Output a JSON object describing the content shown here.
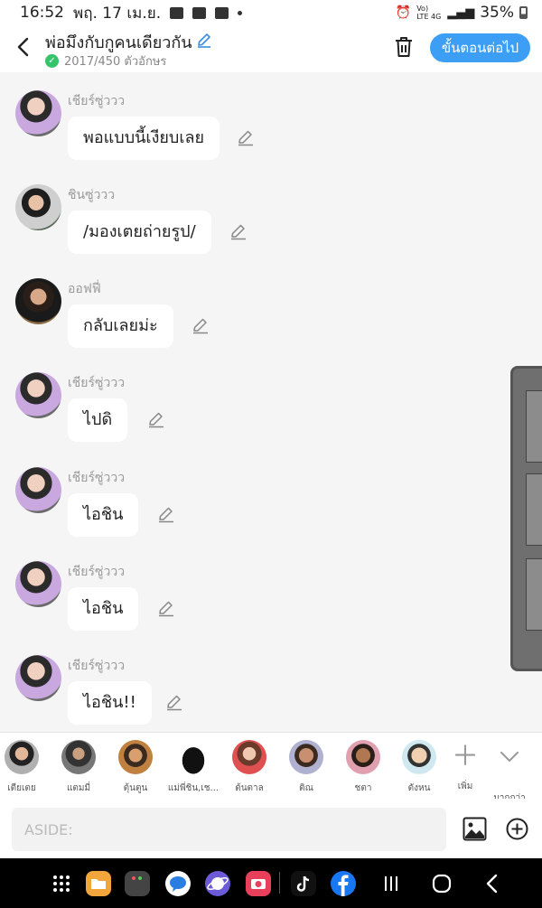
{
  "status_bar": {
    "time": "16:52",
    "date": "พฤ. 17 เม.ย.",
    "network": "Vo) LTE 4G",
    "battery": "35%"
  },
  "header": {
    "title": "พ่อมึงกับกูคนเดียวกัน",
    "char_count": "2017/450 ตัวอักษร",
    "next_button": "ขั้นตอนต่อไป"
  },
  "messages": [
    {
      "sender": "เชียร์ซู่ววว",
      "text": "พอแบบนี้เงียบเลย"
    },
    {
      "sender": "ชินซู่ววว",
      "text": "/มองเตยถ่ายรูป/"
    },
    {
      "sender": "ออฟฟี่",
      "text": "กลับเลยม่ะ"
    },
    {
      "sender": "เชียร์ซู่ววว",
      "text": "ไปดิ"
    },
    {
      "sender": "เชียร์ซู่ววว",
      "text": "ไอชิน"
    },
    {
      "sender": "เชียร์ซู่ววว",
      "text": "ไอชิน"
    },
    {
      "sender": "เชียร์ซู่ววว",
      "text": "ไอชิน!!"
    }
  ],
  "characters": [
    {
      "name": "เตียเตย"
    },
    {
      "name": "แตมมี่"
    },
    {
      "name": "ตุ้นตูน"
    },
    {
      "name": "แม่พี่ชิน,เช..."
    },
    {
      "name": "ต้นตาล"
    },
    {
      "name": "ติณ"
    },
    {
      "name": "ชตา"
    },
    {
      "name": "ตังหน"
    }
  ],
  "char_actions": {
    "add": "เพิ่ม",
    "more": "มากกว่า"
  },
  "input": {
    "placeholder": "ASIDE:"
  },
  "colors": {
    "accent": "#3d9ef5",
    "check": "#35c46a",
    "edit_icon": "#3b8fe0"
  }
}
